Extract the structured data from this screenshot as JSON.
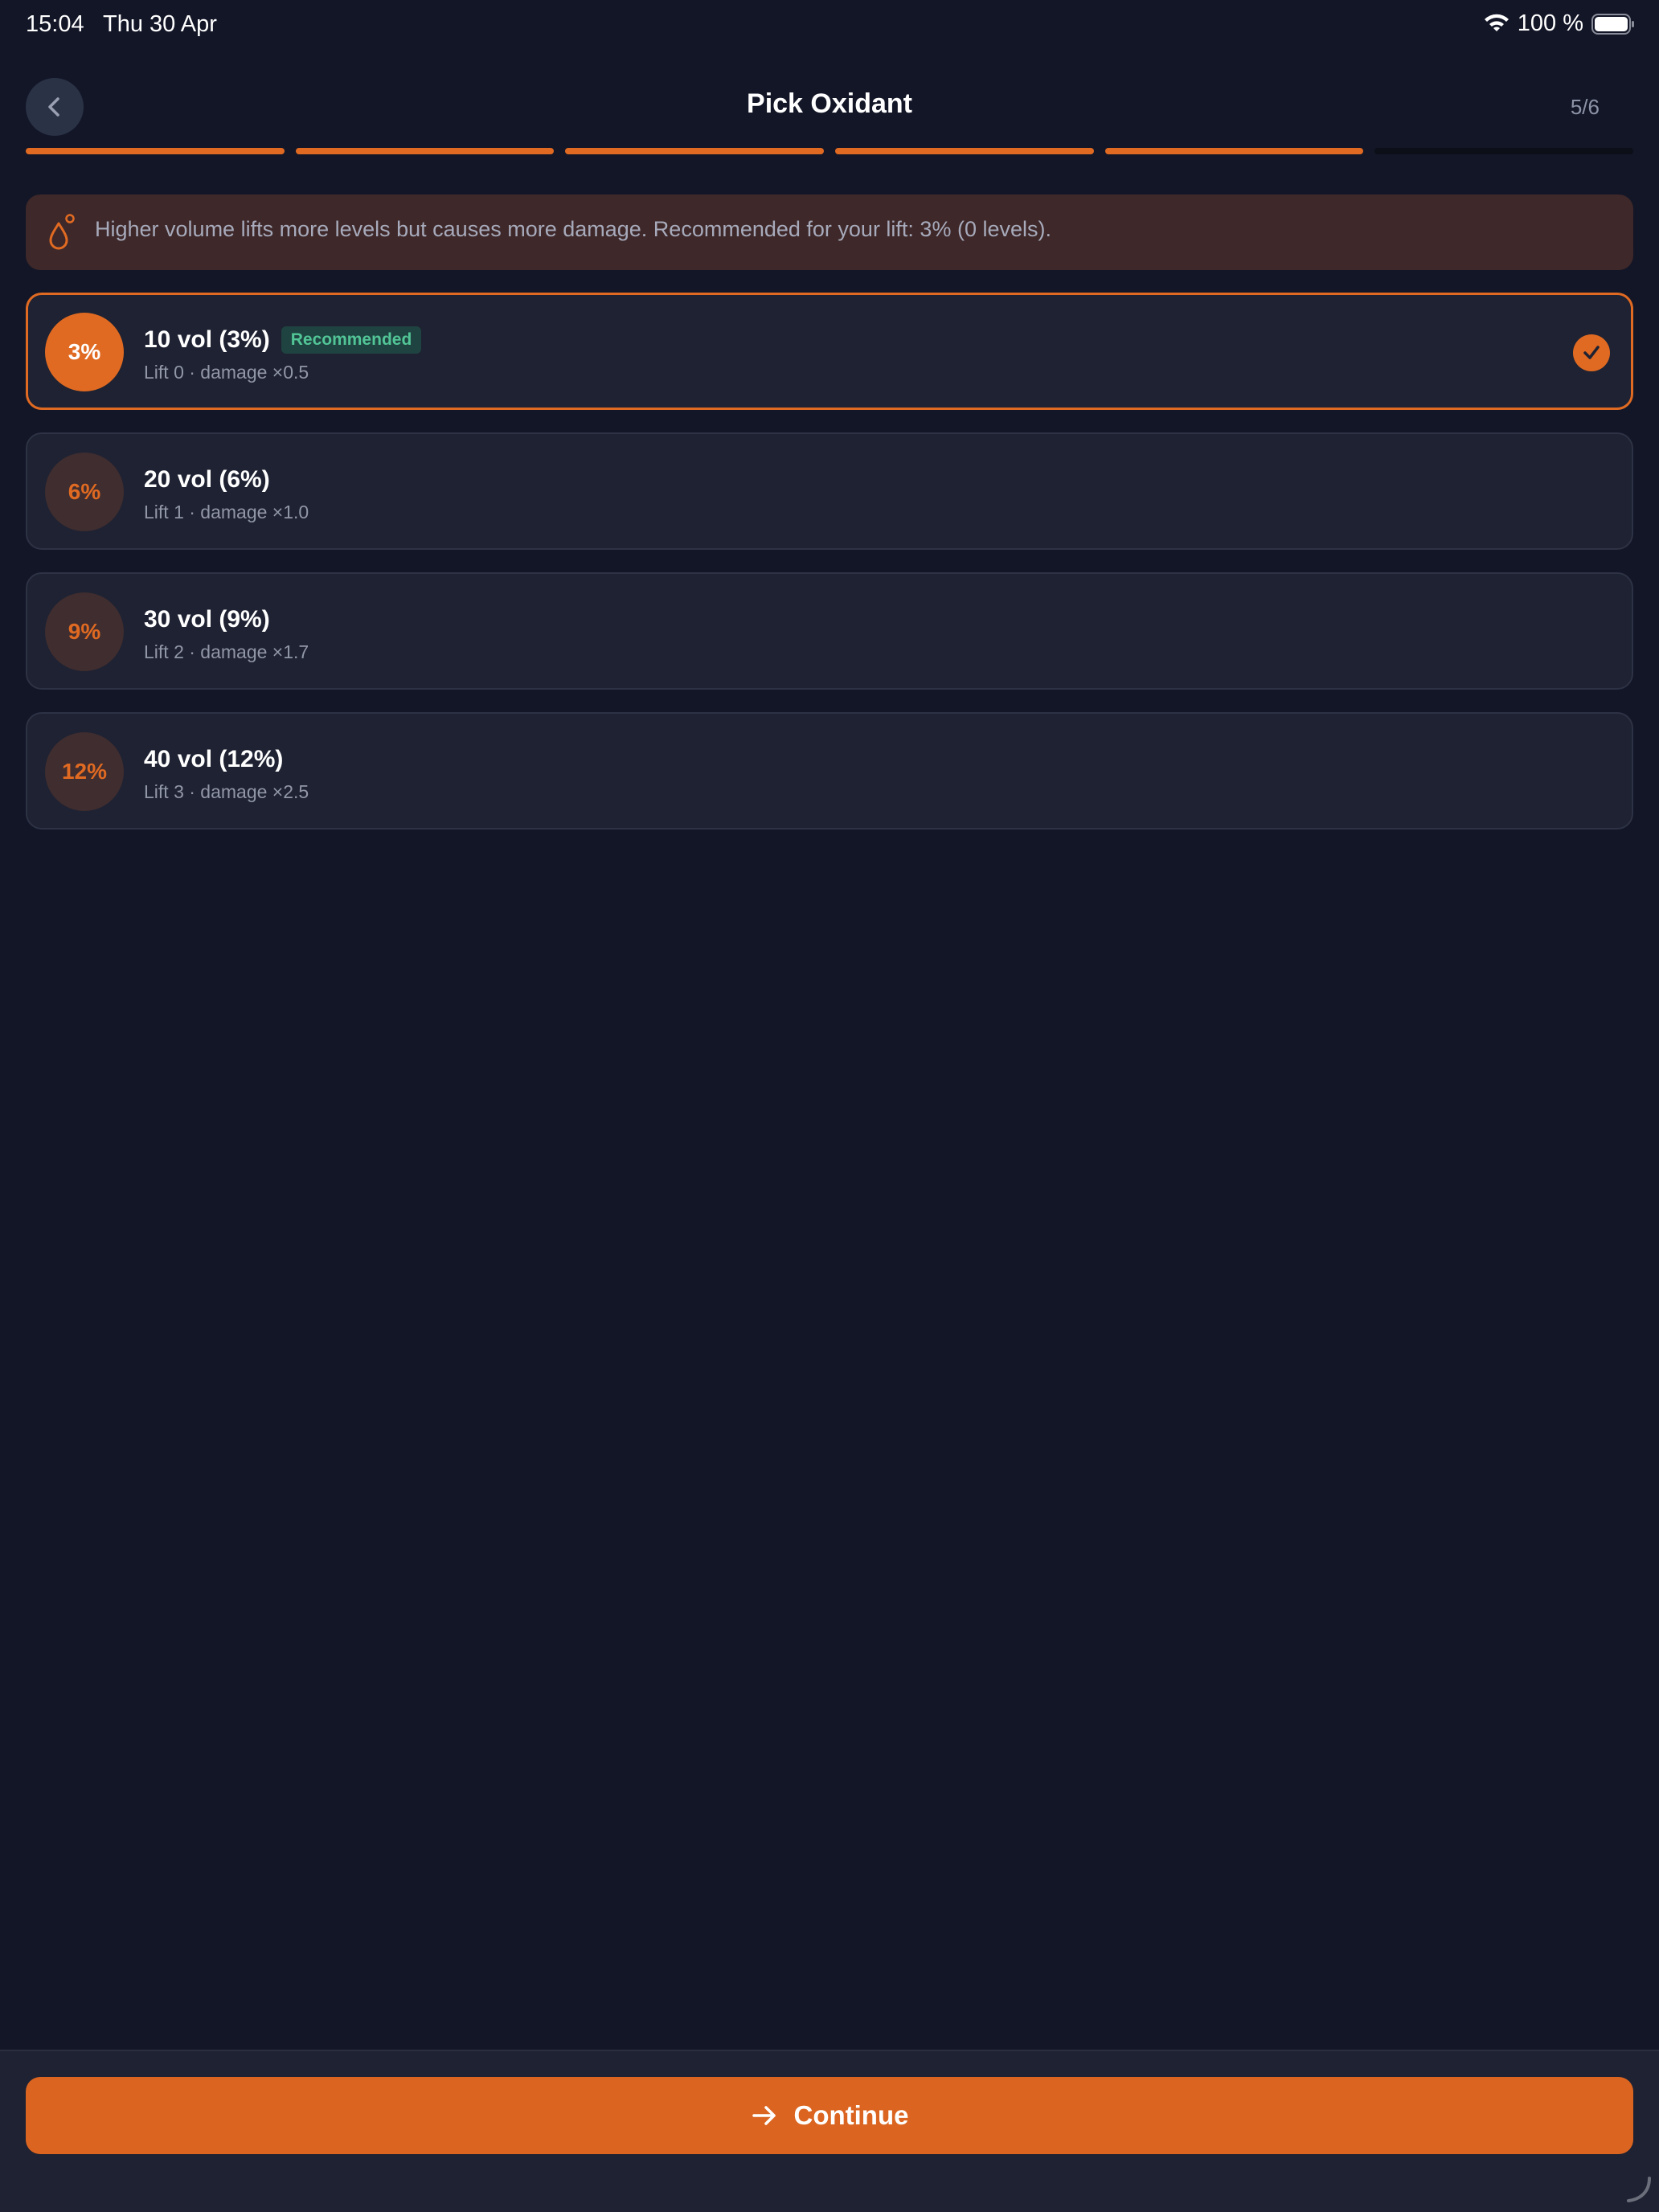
{
  "status_bar": {
    "time": "15:04",
    "date": "Thu 30 Apr",
    "battery": "100 %"
  },
  "header": {
    "title": "Pick Oxidant",
    "step": "5/6",
    "back_icon": "chevron-left-icon"
  },
  "progress": {
    "total_steps": 6,
    "completed_steps": 5,
    "accent_color": "#e06a22"
  },
  "info": {
    "icon": "droplet-icon",
    "text": "Higher volume lifts more levels but causes more damage. Recommended for your lift: 3% (0 levels)."
  },
  "options": [
    {
      "percent": "3%",
      "title": "10 vol (3%)",
      "badge": "Recommended",
      "subtitle": "Lift 0 · damage ×0.5",
      "selected": true
    },
    {
      "percent": "6%",
      "title": "20 vol (6%)",
      "subtitle": "Lift 1 · damage ×1.0",
      "selected": false
    },
    {
      "percent": "9%",
      "title": "30 vol (9%)",
      "subtitle": "Lift 2 · damage ×1.7",
      "selected": false
    },
    {
      "percent": "12%",
      "title": "40 vol (12%)",
      "subtitle": "Lift 3 · damage ×2.5",
      "selected": false
    }
  ],
  "footer": {
    "continue_label": "Continue",
    "continue_icon": "arrow-right-icon"
  },
  "colors": {
    "background": "#131627",
    "card": "#1e2232",
    "accent": "#e06a22",
    "badge_text": "#52c597"
  }
}
